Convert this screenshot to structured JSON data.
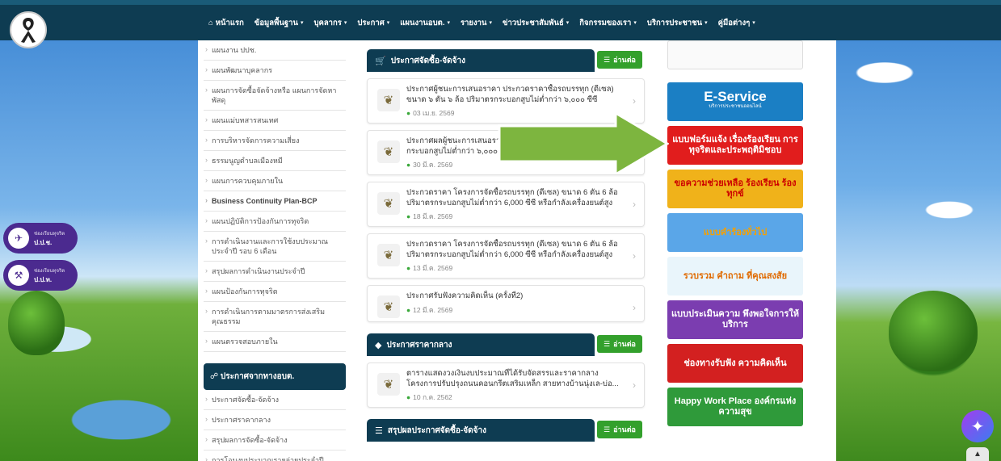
{
  "nav": {
    "items": [
      {
        "label": "หน้าแรก",
        "icon": "home-icon",
        "dropdown": false
      },
      {
        "label": "ข้อมูลพื้นฐาน",
        "dropdown": true
      },
      {
        "label": "บุคลากร",
        "dropdown": true
      },
      {
        "label": "ประกาศ",
        "dropdown": true
      },
      {
        "label": "แผนงานอบต.",
        "dropdown": true
      },
      {
        "label": "รายงาน",
        "dropdown": true
      },
      {
        "label": "ข่าวประชาสัมพันธ์",
        "dropdown": true
      },
      {
        "label": "กิจกรรมของเรา",
        "dropdown": true
      },
      {
        "label": "บริการประชาชน",
        "dropdown": true
      },
      {
        "label": "คู่มือต่างๆ",
        "dropdown": true
      }
    ],
    "caret": "▾",
    "home_glyph": "⌂"
  },
  "sidebar": {
    "items": [
      "แผนงาน ปปช.",
      "แผนพัฒนาบุคลากร",
      "แผนการจัดซื้อจัดจ้างหรือ แผนการจัดหาพัสดุ",
      "แผนแม่บทสารสนเทศ",
      "การบริหารจัดการความเสี่ยง",
      "ธรรมนูญตำบลเมืองหมี",
      "แผนการควบคุมภายใน",
      "Business Continuity Plan-BCP",
      "แผนปฏิบัติการป้องกันการทุจริต",
      "การดำเนินงานและการใช้งบประมาณ ประจำปี รอบ 6 เดือน",
      "สรุปผลการดำเนินงานประจำปี",
      "แผนป้องกันการทุจริต",
      "การดำเนินการตามมาตรการส่งเสริม คุณธรรม",
      "แผนตรวจสอบภายใน"
    ],
    "section_title": "ประกาศจากทางอบต.",
    "section_items": [
      "ประกาศจัดซื้อ-จัดจ้าง",
      "ประกาศราคากลาง",
      "สรุปผลการจัดซื้อ-จัดจ้าง",
      "การโอนงบประมาณรายจ่ายประจำปี"
    ]
  },
  "sections": [
    {
      "title": "ประกาศจัดซื้อ-จัดจ้าง",
      "read_all": "อ่านต่อ",
      "cards": [
        {
          "title": "ประกาศผู้ชนะการเสนอราคา ประกวดราคาซื้อรถบรรทุก (ดีเซล) ขนาด ๖ ตัน ๖ ล้อ ปริมาตรกระบอกสูบไม่ต่ำกว่า ๖,๐๐๐ ซีซี หรือ...",
          "date": "03 เม.ย. 2569"
        },
        {
          "title": "ประกาศผลผู้ชนะการเสนอราคา ขนาด ๖ ตัน ๖ ล้อ ปริมาตรกระบอกสูบไม่ต่ำกว่า ๖,๐๐๐ ซีซี หรือ...",
          "date": "30 มี.ค. 2569"
        },
        {
          "title": "ประกวดราคา โครงการจัดซื้อรถบรรทุก (ดีเซล) ขนาด 6 ตัน 6 ล้อ ปริมาตรกระบอกสูบไม่ต่ำกว่า 6,000 ซีซี หรือกำลังเครื่องยนต์สูงสุ...",
          "date": "18 มี.ค. 2569"
        },
        {
          "title": "ประกวดราคา โครงการจัดซื้อรถบรรทุก (ดีเซล) ขนาด 6 ตัน 6 ล้อ ปริมาตรกระบอกสูบไม่ต่ำกว่า 6,000 ซีซี หรือกำลังเครื่องยนต์สูงสุ...",
          "date": "13 มี.ค. 2569"
        },
        {
          "title": "ประกาศรับฟังความคิดเห็น (ครั้งที่2)",
          "date": "12 มี.ค. 2569"
        }
      ]
    },
    {
      "title": "ประกาศราคากลาง",
      "read_all": "อ่านต่อ",
      "cards": [
        {
          "title": "ตารางแสดงวงเงินงบประมาณที่ได้รับจัดสรรและราคากลาง โครงการปรับปรุงถนนคอนกรีตเสริมเหล็ก สายทางบ้านนุ่งเล-บ่อ...",
          "date": "10 ก.ค. 2562"
        }
      ]
    },
    {
      "title": "สรุปผลประกาศจัดซื้อ-จัดจ้าง",
      "read_all": "อ่านต่อ",
      "cards": []
    }
  ],
  "banners": [
    {
      "label": "E-Service",
      "sub": "บริการประชาชนออนไลน์",
      "bg": "#1b7fc4"
    },
    {
      "label": "แบบฟอร์มแจ้ง เรื่องร้องเรียน การทุจริตและประพฤติมิชอบ",
      "bg": "#e11d1d"
    },
    {
      "label": "ขอความช่วยเหลือ ร้องเรียน ร้องทุกข์",
      "bg": "#f0b21a"
    },
    {
      "label": "แบบคำร้องทั่วไป",
      "bg": "#5aa6e8"
    },
    {
      "label": "รวบรวม คำถาม ที่คุณสงสัย",
      "bg": "#3bb0e0"
    },
    {
      "label": "แบบประเมินความ พึงพอใจการให้บริการ",
      "bg": "#7b3db0"
    },
    {
      "label": "ช่องทางรับฟัง ความคิดเห็น",
      "bg": "#d32020"
    },
    {
      "label": "Happy Work Place องค์กรแห่งความสุข",
      "bg": "#2f9a3a"
    }
  ],
  "float_buttons": [
    {
      "small": "ช่องเรียนทุจริต",
      "label": "ป.ป.ช."
    },
    {
      "small": "ช่องเรียนทุจริต",
      "label": "ป.ป.ท."
    }
  ],
  "icons": {
    "emblem": "❦",
    "chevron": "›",
    "clock": "●",
    "cart": "🛒",
    "tag": "◆",
    "menu": "☰",
    "share": "☍",
    "messenger": "✦",
    "up": "▲",
    "megaphone": "✈",
    "gavel": "⚒"
  },
  "colors": {
    "nav_bg": "#0e3c52",
    "accent_green": "#33a02c",
    "arrow_green": "#7db53f"
  }
}
